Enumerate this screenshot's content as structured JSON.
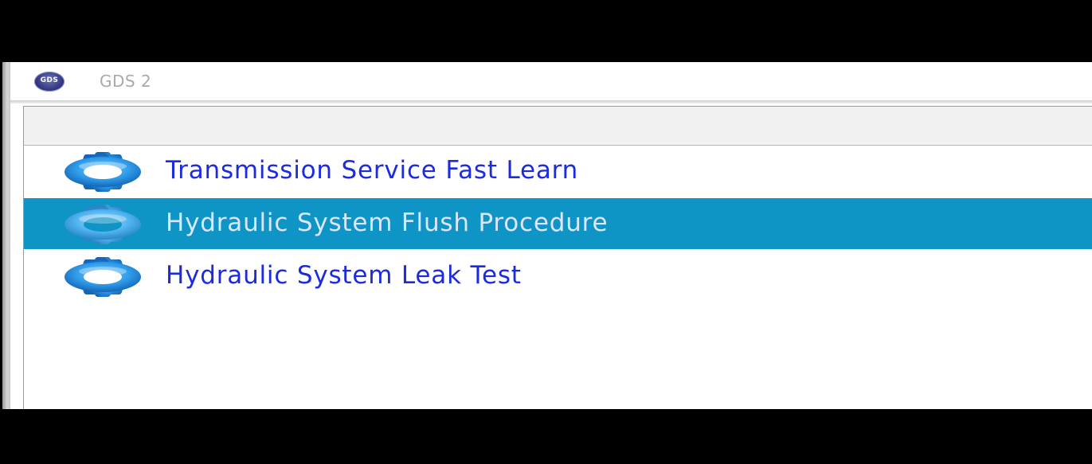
{
  "window": {
    "title": "GDS 2",
    "logo_text": "GDS",
    "logo_icon": "gds-logo-icon"
  },
  "colors": {
    "selection": "#0e95c6",
    "item_text": "#1c2be0",
    "selected_text": "#dbe6ff",
    "gear": "#2e9be8"
  },
  "list": {
    "items": [
      {
        "label": "Transmission Service Fast Learn",
        "icon": "gear-icon",
        "selected": false
      },
      {
        "label": "Hydraulic System Flush Procedure",
        "icon": "gear-icon",
        "selected": true
      },
      {
        "label": "Hydraulic System Leak Test",
        "icon": "gear-icon",
        "selected": false
      }
    ]
  }
}
